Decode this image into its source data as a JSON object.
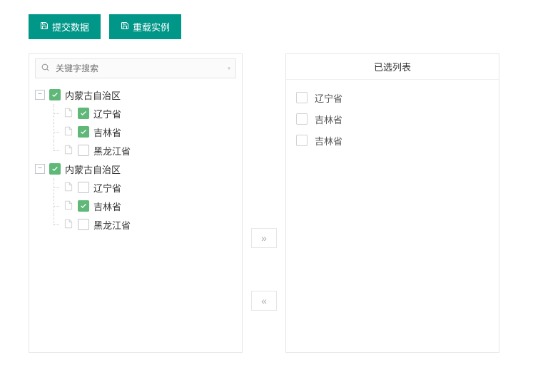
{
  "toolbar": {
    "submit_label": "提交数据",
    "reload_label": "重载实例"
  },
  "search": {
    "placeholder": "关键字搜索"
  },
  "tree": [
    {
      "label": "内蒙古自治区",
      "checked": true,
      "children": [
        {
          "label": "辽宁省",
          "checked": true
        },
        {
          "label": "吉林省",
          "checked": true
        },
        {
          "label": "黑龙江省",
          "checked": false
        }
      ]
    },
    {
      "label": "内蒙古自治区",
      "checked": true,
      "children": [
        {
          "label": "辽宁省",
          "checked": false
        },
        {
          "label": "吉林省",
          "checked": true
        },
        {
          "label": "黑龙江省",
          "checked": false
        }
      ]
    }
  ],
  "right": {
    "header": "已选列表",
    "items": [
      {
        "label": "辽宁省"
      },
      {
        "label": "吉林省"
      },
      {
        "label": "吉林省"
      }
    ]
  }
}
